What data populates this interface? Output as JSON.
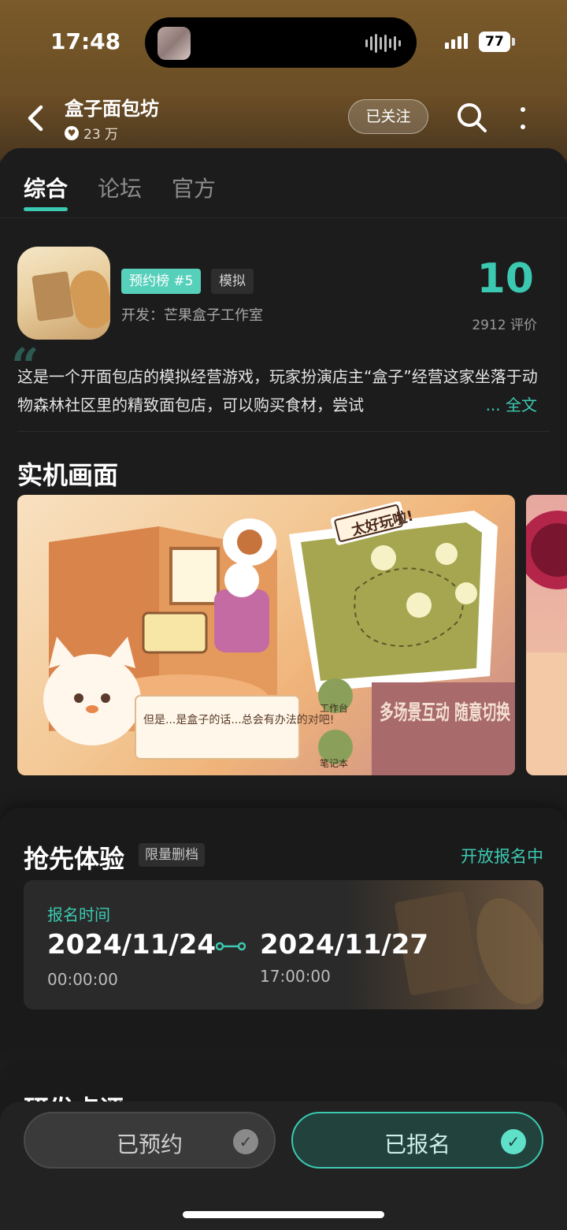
{
  "status_bar": {
    "time": "17:48",
    "battery": "77"
  },
  "header": {
    "title": "盒子面包坊",
    "followers": "23 万",
    "follow_label": "已关注"
  },
  "tabs": [
    {
      "label": "综合",
      "active": true
    },
    {
      "label": "论坛",
      "active": false
    },
    {
      "label": "官方",
      "active": false
    }
  ],
  "game": {
    "rank_badge": "预约榜 #5",
    "genre": "模拟",
    "developer": "开发：芒果盒子工作室",
    "score": "10",
    "rating_count": "2912 评价",
    "description": "这是一个开面包店的模拟经营游戏，玩家扮演店主“盒子”经营这家坐落于动物森林社区里的精致面包店，可以购买食材，尝试",
    "more_label": "... 全文"
  },
  "screenshots": {
    "section_title": "实机画面",
    "caption_top": "太好玩啦!",
    "caption_bubble": "但是...是盒子的话...总会有办法的对吧!",
    "caption_right": "多场景互动 随意切换",
    "side_label_1": "工作台",
    "side_label_2": "笔记本"
  },
  "early_access": {
    "title": "抢先体验",
    "tag": "限量删档",
    "status": "开放报名中",
    "signup_label": "报名时间",
    "start_date": "2024/11/24",
    "start_time": "00:00:00",
    "end_date": "2024/11/27",
    "end_time": "17:00:00"
  },
  "next_section": {
    "title": "研发点评"
  },
  "bottom": {
    "reserved_label": "已预约",
    "registered_label": "已报名"
  },
  "colors": {
    "accent": "#3cc9b1",
    "header_bg": "#6b4e25",
    "background": "#1c1c1c"
  }
}
